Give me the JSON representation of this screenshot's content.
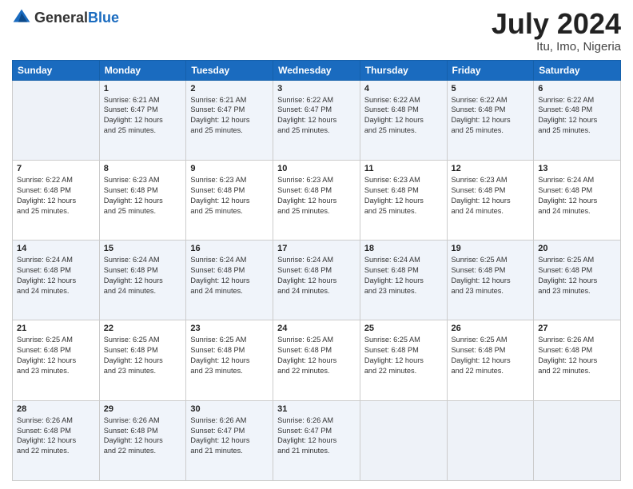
{
  "header": {
    "logo_general": "General",
    "logo_blue": "Blue",
    "month_title": "July 2024",
    "location": "Itu, Imo, Nigeria"
  },
  "days_of_week": [
    "Sunday",
    "Monday",
    "Tuesday",
    "Wednesday",
    "Thursday",
    "Friday",
    "Saturday"
  ],
  "weeks": [
    [
      {
        "day": "",
        "info": ""
      },
      {
        "day": "1",
        "info": "Sunrise: 6:21 AM\nSunset: 6:47 PM\nDaylight: 12 hours\nand 25 minutes."
      },
      {
        "day": "2",
        "info": "Sunrise: 6:21 AM\nSunset: 6:47 PM\nDaylight: 12 hours\nand 25 minutes."
      },
      {
        "day": "3",
        "info": "Sunrise: 6:22 AM\nSunset: 6:47 PM\nDaylight: 12 hours\nand 25 minutes."
      },
      {
        "day": "4",
        "info": "Sunrise: 6:22 AM\nSunset: 6:48 PM\nDaylight: 12 hours\nand 25 minutes."
      },
      {
        "day": "5",
        "info": "Sunrise: 6:22 AM\nSunset: 6:48 PM\nDaylight: 12 hours\nand 25 minutes."
      },
      {
        "day": "6",
        "info": "Sunrise: 6:22 AM\nSunset: 6:48 PM\nDaylight: 12 hours\nand 25 minutes."
      }
    ],
    [
      {
        "day": "7",
        "info": "Sunrise: 6:22 AM\nSunset: 6:48 PM\nDaylight: 12 hours\nand 25 minutes."
      },
      {
        "day": "8",
        "info": "Sunrise: 6:23 AM\nSunset: 6:48 PM\nDaylight: 12 hours\nand 25 minutes."
      },
      {
        "day": "9",
        "info": "Sunrise: 6:23 AM\nSunset: 6:48 PM\nDaylight: 12 hours\nand 25 minutes."
      },
      {
        "day": "10",
        "info": "Sunrise: 6:23 AM\nSunset: 6:48 PM\nDaylight: 12 hours\nand 25 minutes."
      },
      {
        "day": "11",
        "info": "Sunrise: 6:23 AM\nSunset: 6:48 PM\nDaylight: 12 hours\nand 25 minutes."
      },
      {
        "day": "12",
        "info": "Sunrise: 6:23 AM\nSunset: 6:48 PM\nDaylight: 12 hours\nand 24 minutes."
      },
      {
        "day": "13",
        "info": "Sunrise: 6:24 AM\nSunset: 6:48 PM\nDaylight: 12 hours\nand 24 minutes."
      }
    ],
    [
      {
        "day": "14",
        "info": "Sunrise: 6:24 AM\nSunset: 6:48 PM\nDaylight: 12 hours\nand 24 minutes."
      },
      {
        "day": "15",
        "info": "Sunrise: 6:24 AM\nSunset: 6:48 PM\nDaylight: 12 hours\nand 24 minutes."
      },
      {
        "day": "16",
        "info": "Sunrise: 6:24 AM\nSunset: 6:48 PM\nDaylight: 12 hours\nand 24 minutes."
      },
      {
        "day": "17",
        "info": "Sunrise: 6:24 AM\nSunset: 6:48 PM\nDaylight: 12 hours\nand 24 minutes."
      },
      {
        "day": "18",
        "info": "Sunrise: 6:24 AM\nSunset: 6:48 PM\nDaylight: 12 hours\nand 23 minutes."
      },
      {
        "day": "19",
        "info": "Sunrise: 6:25 AM\nSunset: 6:48 PM\nDaylight: 12 hours\nand 23 minutes."
      },
      {
        "day": "20",
        "info": "Sunrise: 6:25 AM\nSunset: 6:48 PM\nDaylight: 12 hours\nand 23 minutes."
      }
    ],
    [
      {
        "day": "21",
        "info": "Sunrise: 6:25 AM\nSunset: 6:48 PM\nDaylight: 12 hours\nand 23 minutes."
      },
      {
        "day": "22",
        "info": "Sunrise: 6:25 AM\nSunset: 6:48 PM\nDaylight: 12 hours\nand 23 minutes."
      },
      {
        "day": "23",
        "info": "Sunrise: 6:25 AM\nSunset: 6:48 PM\nDaylight: 12 hours\nand 23 minutes."
      },
      {
        "day": "24",
        "info": "Sunrise: 6:25 AM\nSunset: 6:48 PM\nDaylight: 12 hours\nand 22 minutes."
      },
      {
        "day": "25",
        "info": "Sunrise: 6:25 AM\nSunset: 6:48 PM\nDaylight: 12 hours\nand 22 minutes."
      },
      {
        "day": "26",
        "info": "Sunrise: 6:25 AM\nSunset: 6:48 PM\nDaylight: 12 hours\nand 22 minutes."
      },
      {
        "day": "27",
        "info": "Sunrise: 6:26 AM\nSunset: 6:48 PM\nDaylight: 12 hours\nand 22 minutes."
      }
    ],
    [
      {
        "day": "28",
        "info": "Sunrise: 6:26 AM\nSunset: 6:48 PM\nDaylight: 12 hours\nand 22 minutes."
      },
      {
        "day": "29",
        "info": "Sunrise: 6:26 AM\nSunset: 6:48 PM\nDaylight: 12 hours\nand 22 minutes."
      },
      {
        "day": "30",
        "info": "Sunrise: 6:26 AM\nSunset: 6:47 PM\nDaylight: 12 hours\nand 21 minutes."
      },
      {
        "day": "31",
        "info": "Sunrise: 6:26 AM\nSunset: 6:47 PM\nDaylight: 12 hours\nand 21 minutes."
      },
      {
        "day": "",
        "info": ""
      },
      {
        "day": "",
        "info": ""
      },
      {
        "day": "",
        "info": ""
      }
    ]
  ]
}
